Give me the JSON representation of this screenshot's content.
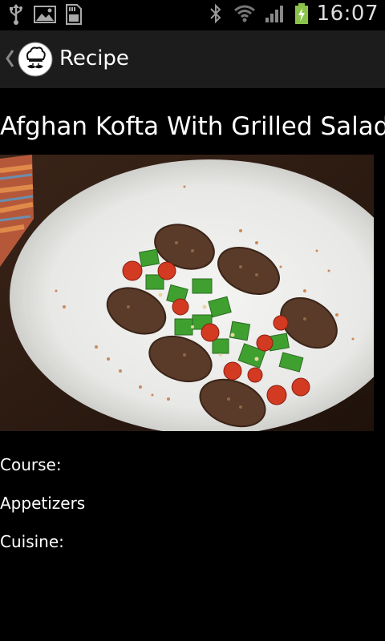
{
  "status_bar": {
    "time": "16:07",
    "icons": [
      "usb-icon",
      "image-icon",
      "sd-card-icon",
      "bluetooth-icon",
      "wifi-icon",
      "signal-icon",
      "battery-charging-icon"
    ]
  },
  "action_bar": {
    "title": "Recipe",
    "logo": "chef-logo-icon"
  },
  "recipe": {
    "title": "Afghan Kofta With Grilled Salad",
    "course_label": "Course:",
    "course_value": "Appetizers",
    "cuisine_label": "Cuisine:"
  },
  "colors": {
    "background": "#000000",
    "action_bar": "#1c1c1c",
    "battery": "#8bc34a"
  }
}
